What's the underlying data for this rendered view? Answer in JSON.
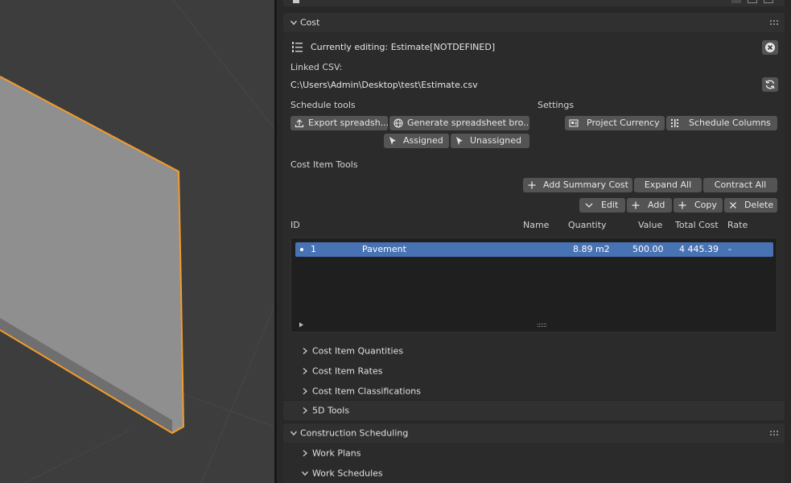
{
  "cost": {
    "title": "Cost",
    "editing": "Currently editing: Estimate[NOTDEFINED]",
    "linked_csv_label": "Linked CSV:",
    "linked_csv_path": "C:\\Users\\Admin\\Desktop\\test\\Estimate.csv",
    "schedule_tools_label": "Schedule tools",
    "settings_label": "Settings",
    "export_button": "Export spreadsh...",
    "generate_button": "Generate spreadsheet bro...",
    "assigned_button": "Assigned",
    "unassigned_button": "Unassigned",
    "currency_button": "Project Currency",
    "columns_button": "Schedule Columns",
    "cost_item_tools_label": "Cost Item Tools",
    "add_summary_button": "Add Summary Cost",
    "expand_button": "Expand All",
    "contract_button": "Contract All",
    "edit_button": "Edit",
    "add_button": "Add",
    "copy_button": "Copy",
    "delete_button": "Delete"
  },
  "table": {
    "headers": [
      "ID",
      "Name",
      "Quantity",
      "Value",
      "Total Cost",
      "Rate"
    ],
    "rows": [
      {
        "id": "1",
        "name": "Pavement",
        "quantity": "8.89 m2",
        "value": "500.00",
        "total": "4 445.39",
        "rate": "-"
      }
    ]
  },
  "subpanels": [
    "Cost Item Quantities",
    "Cost Item Rates",
    "Cost Item Classifications",
    "5D Tools"
  ],
  "scheduling": {
    "title": "Construction Scheduling",
    "items": [
      "Work Plans",
      "Work Schedules"
    ]
  },
  "colors": {
    "accent": "#4772b3",
    "selection_outline": "#f39c2a"
  },
  "icons": [
    "list-numbered-icon",
    "close-circle-icon",
    "refresh-icon",
    "export-icon",
    "globe-icon",
    "cursor-icon",
    "currency-icon",
    "columns-icon",
    "plus-icon",
    "chevron-down-icon",
    "chevron-right-icon",
    "x-icon",
    "drag-handle-icon",
    "disclosure-triangle-icon"
  ]
}
